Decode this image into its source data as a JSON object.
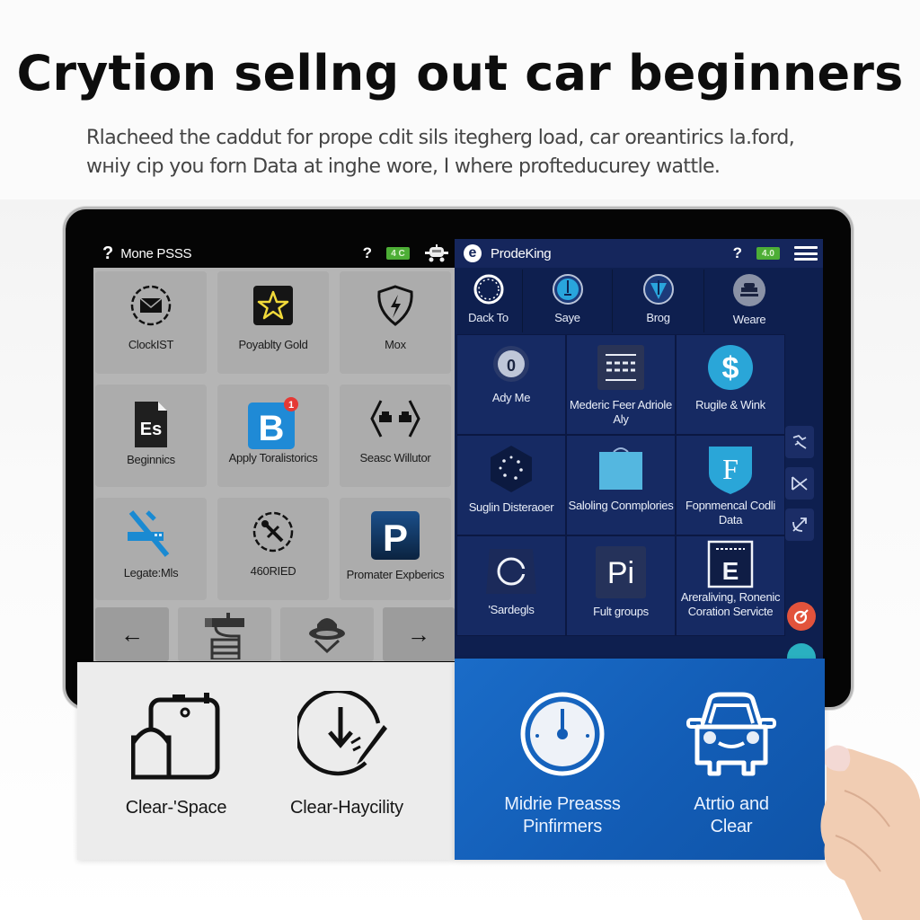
{
  "header": {
    "headline": "Crytion sellng out car beginners",
    "subline_1": "Rlacheed the caddut for prope cdit sils itegherg load, car oreantirics la.ford,",
    "subline_2": "wніу cip you forn Data at inghe wore, I where profteducurey wattle."
  },
  "left_panel": {
    "title": "Mone PSSS",
    "help_label": "?",
    "battery_badge": "4 C",
    "tiles": [
      {
        "label": "ClockIST",
        "icon": "envelope-icon"
      },
      {
        "label": "Poyablty Gold",
        "icon": "star-icon"
      },
      {
        "label": "Mox",
        "icon": "shield-bolt-icon"
      },
      {
        "label": "Beginnics",
        "icon": "document-es-icon"
      },
      {
        "label": "Apply Toralistorics",
        "icon": "b-app-icon",
        "badge": "1"
      },
      {
        "label": "Seasc Willutor",
        "icon": "cars-hexagon-icon"
      },
      {
        "label": "Legate:Mls",
        "icon": "wrench-crossed-icon"
      },
      {
        "label": "460RIED",
        "icon": "tools-circle-icon"
      },
      {
        "label": "Promater Expberics",
        "icon": "parking-p-icon"
      }
    ],
    "nav": {
      "prev": "←",
      "next": "→"
    }
  },
  "right_panel": {
    "title": "ProdeKing",
    "logo_letter": "e",
    "help_label": "?",
    "battery_badge": "4.0",
    "top_items": [
      {
        "label": "Dack To",
        "icon": "dial-icon"
      },
      {
        "label": "Saye",
        "icon": "pin-icon"
      },
      {
        "label": "Brog",
        "icon": "arrow-down-shield-icon"
      },
      {
        "label": "Weare",
        "icon": "engine-icon"
      }
    ],
    "tiles": [
      {
        "label": "Ady Me",
        "icon": "lock-knob-icon"
      },
      {
        "label": "Mederic Feer Adriole Aly",
        "icon": "keyboard-icon"
      },
      {
        "label": "Rugile & Wink",
        "icon": "dollar-icon"
      },
      {
        "label": "Suglin Disteraoer",
        "icon": "constellation-icon"
      },
      {
        "label": "Saloling Conmplories",
        "icon": "bag-icon"
      },
      {
        "label": "Fopnmencal Codli Data",
        "icon": "f-shield-icon"
      },
      {
        "label": "'Sardegls",
        "icon": "circle-refresh-icon"
      },
      {
        "label": "Fult groups",
        "icon": "pi-icon",
        "glyph": "Pi"
      },
      {
        "label": "Areraliving, Ronenic Coration Servicte",
        "icon": "e-badge-icon",
        "glyph": "E"
      }
    ],
    "rail_icons": [
      "figure-icon",
      "scissors-icon",
      "bow-arrow-icon",
      "target-icon",
      "chat-icon"
    ]
  },
  "feature_cards": {
    "left": [
      {
        "label": "Clear-'Space",
        "icon": "battery-tank-icon"
      },
      {
        "label": "Clear-Haycility",
        "icon": "download-pen-icon"
      }
    ],
    "right": [
      {
        "label_1": "Midrie Preasss",
        "label_2": "Pinfirmers",
        "icon": "gauge-icon"
      },
      {
        "label_1": "Atrtio and",
        "label_2": "Clear",
        "icon": "car-front-icon"
      }
    ]
  },
  "colors": {
    "left_tile_bg": "#acacac",
    "right_panel_bg": "#0e1f4f",
    "right_tile_bg": "#162a63",
    "accent_blue": "#1a6cc8",
    "badge_green": "#4dae36",
    "badge_red": "#e53935",
    "teal": "#2ab0c0",
    "orange_red": "#e2533c"
  }
}
